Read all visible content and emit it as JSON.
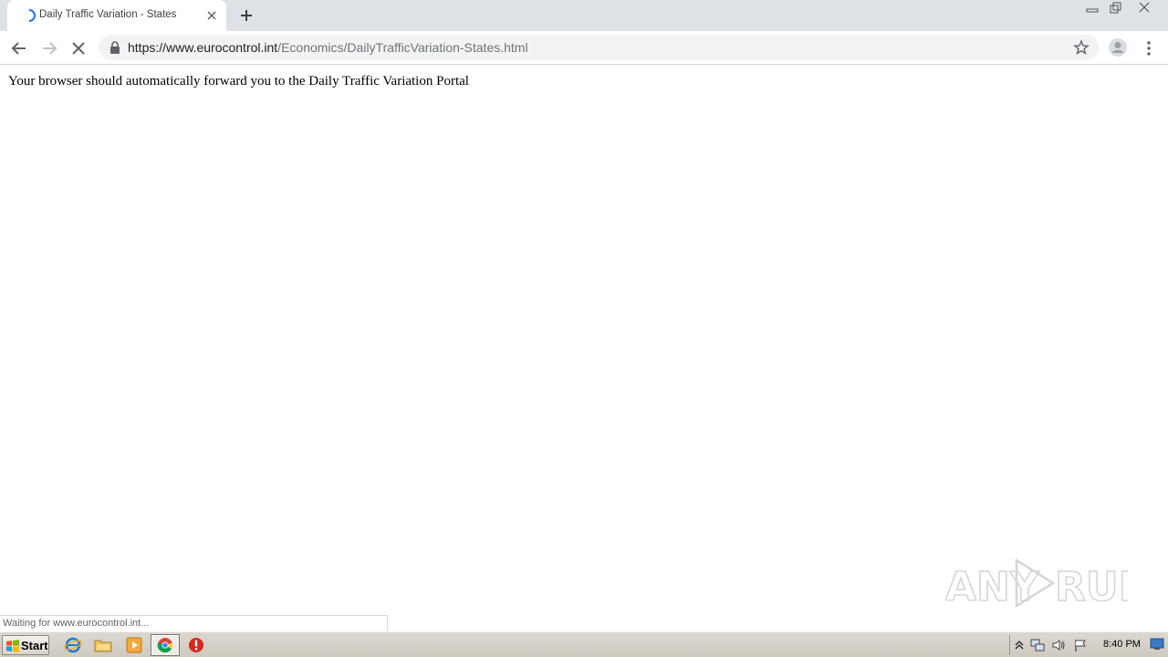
{
  "browser": {
    "tab": {
      "title": "Daily Traffic Variation - States"
    },
    "url": {
      "domain_part": "https://www.eurocontrol.int",
      "path_part": "/Economics/DailyTrafficVariation-States.html"
    }
  },
  "page": {
    "message": "Your browser should automatically forward you to the Daily Traffic Variation Portal"
  },
  "status_bar": {
    "text": "Waiting for www.eurocontrol.int..."
  },
  "watermark": {
    "text": "ANY RUN"
  },
  "taskbar": {
    "start_label": "Start",
    "clock": "8:40 PM"
  },
  "colors": {
    "tab_strip": "#dee1e6",
    "omnibox": "#f1f3f4",
    "taskbar": "#d4d0c8"
  }
}
